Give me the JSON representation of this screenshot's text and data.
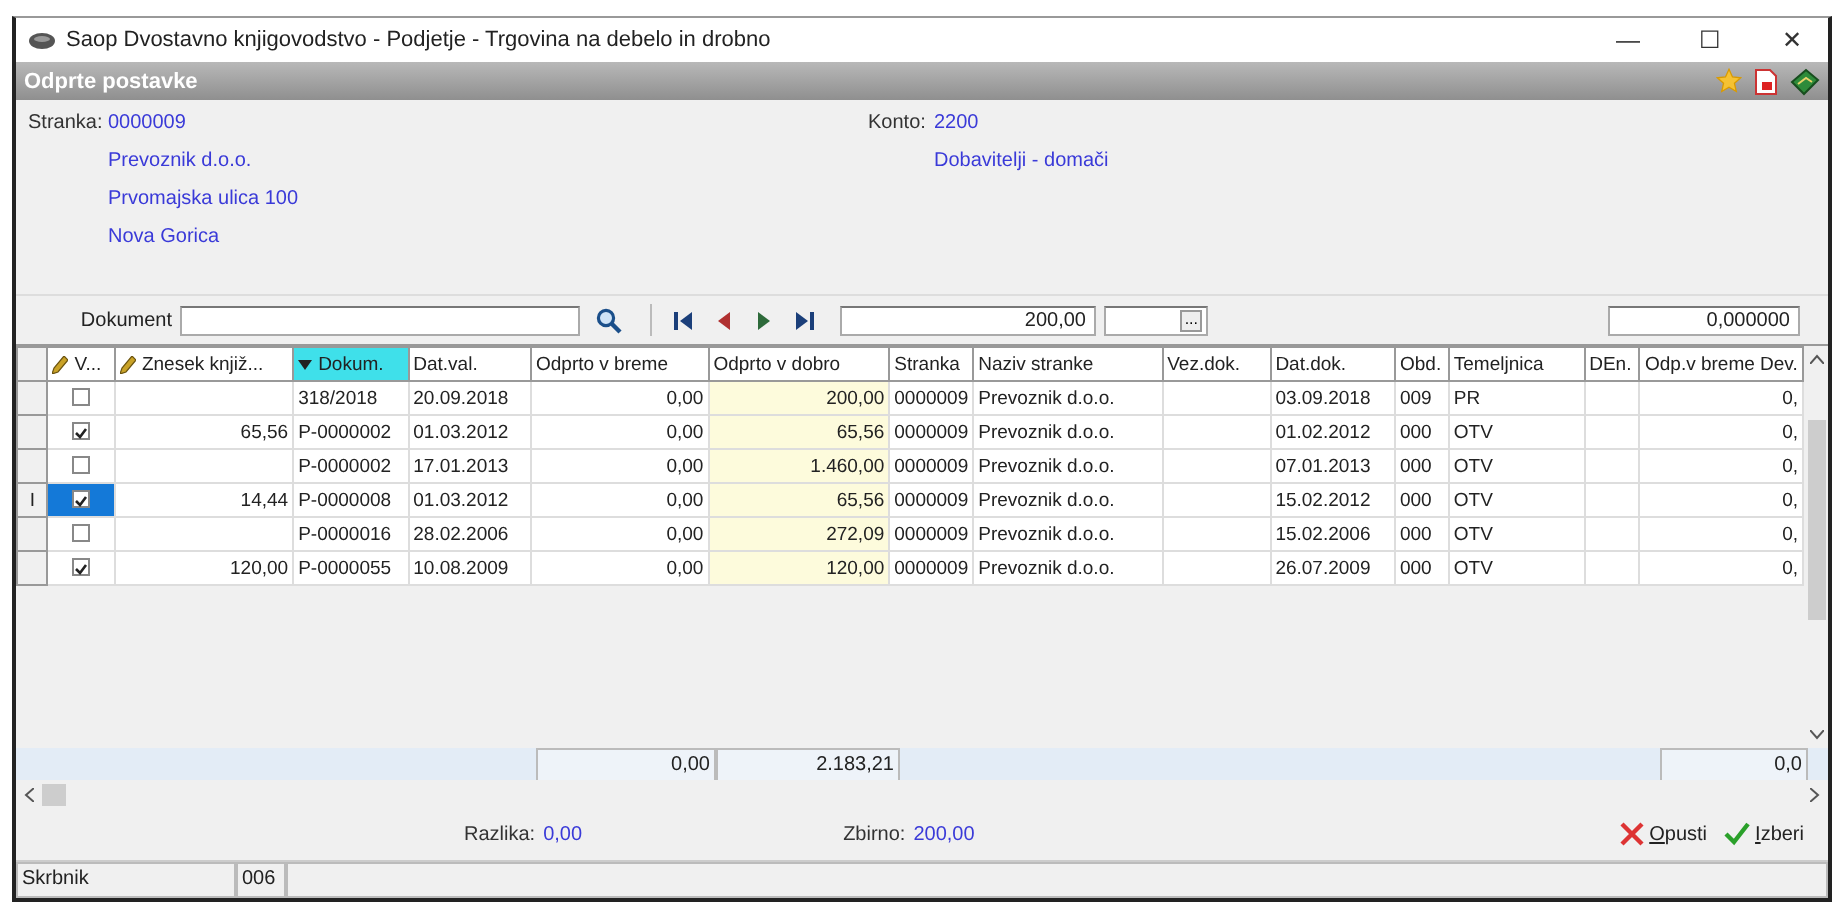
{
  "window": {
    "title": "Saop Dvostavno knjigovodstvo - Podjetje - Trgovina na debelo in drobno",
    "controls": [
      "—",
      "☐",
      "✕"
    ]
  },
  "header": {
    "title": "Odprte postavke"
  },
  "info": {
    "stranka_label": "Stranka:",
    "stranka_lines": [
      "0000009",
      "Prevoznik d.o.o.",
      "Prvomajska ulica 100",
      "Nova Gorica"
    ],
    "konto_label": "Konto:",
    "konto_lines": [
      "2200",
      "Dobavitelji - domači"
    ]
  },
  "toolbar": {
    "dokument_label": "Dokument",
    "amount": "200,00",
    "ellipsis": "...",
    "rate": "0,000000"
  },
  "columns": [
    {
      "label": "V...",
      "kind": "check",
      "editable": true,
      "sorted": false
    },
    {
      "label": "Znesek knjiž...",
      "kind": "amount",
      "editable": true,
      "sorted": false
    },
    {
      "label": "Dokum.",
      "kind": "text",
      "editable": false,
      "sorted": true
    },
    {
      "label": "Dat.val.",
      "kind": "text",
      "editable": false,
      "sorted": false
    },
    {
      "label": "Odprto v breme",
      "kind": "amount",
      "editable": false,
      "sorted": false,
      "total": "0,00"
    },
    {
      "label": "Odprto v dobro",
      "kind": "open",
      "editable": false,
      "sorted": false,
      "total": "2.183,21"
    },
    {
      "label": "Stranka",
      "kind": "text",
      "editable": false,
      "sorted": false
    },
    {
      "label": "Naziv stranke",
      "kind": "text",
      "editable": false,
      "sorted": false
    },
    {
      "label": "Vez.dok.",
      "kind": "text",
      "editable": false,
      "sorted": false
    },
    {
      "label": "Dat.dok.",
      "kind": "text",
      "editable": false,
      "sorted": false
    },
    {
      "label": "Obd.",
      "kind": "text",
      "editable": false,
      "sorted": false
    },
    {
      "label": "Temeljnica",
      "kind": "text",
      "editable": false,
      "sorted": false
    },
    {
      "label": "DEn.",
      "kind": "text",
      "editable": false,
      "sorted": false
    },
    {
      "label": "Odp.v breme Dev.",
      "kind": "amount",
      "editable": false,
      "sorted": false,
      "total": "0,0"
    }
  ],
  "rows": [
    {
      "checked": false,
      "selected": false,
      "cells": [
        null,
        null,
        "318/2018",
        "20.09.2018",
        "0,00",
        "200,00",
        "0000009",
        "Prevoznik d.o.o.",
        null,
        "03.09.2018",
        "009",
        "PR",
        null,
        "0,"
      ]
    },
    {
      "checked": true,
      "selected": false,
      "cells": [
        null,
        "65,56",
        "P-0000002",
        "01.03.2012",
        "0,00",
        "65,56",
        "0000009",
        "Prevoznik d.o.o.",
        null,
        "01.02.2012",
        "000",
        "OTV",
        null,
        "0,"
      ]
    },
    {
      "checked": false,
      "selected": false,
      "cells": [
        null,
        null,
        "P-0000002",
        "17.01.2013",
        "0,00",
        "1.460,00",
        "0000009",
        "Prevoznik d.o.o.",
        null,
        "07.01.2013",
        "000",
        "OTV",
        null,
        "0,"
      ]
    },
    {
      "checked": true,
      "selected": true,
      "row_marker": "I",
      "cells": [
        null,
        "14,44",
        "P-0000008",
        "01.03.2012",
        "0,00",
        "65,56",
        "0000009",
        "Prevoznik d.o.o.",
        null,
        "15.02.2012",
        "000",
        "OTV",
        null,
        "0,"
      ]
    },
    {
      "checked": false,
      "selected": false,
      "cells": [
        null,
        null,
        "P-0000016",
        "28.02.2006",
        "0,00",
        "272,09",
        "0000009",
        "Prevoznik d.o.o.",
        null,
        "15.02.2006",
        "000",
        "OTV",
        null,
        "0,"
      ]
    },
    {
      "checked": true,
      "selected": false,
      "cells": [
        null,
        "120,00",
        "P-0000055",
        "10.08.2009",
        "0,00",
        "120,00",
        "0000009",
        "Prevoznik d.o.o.",
        null,
        "26.07.2009",
        "000",
        "OTV",
        null,
        "0,"
      ]
    }
  ],
  "footer": {
    "razlika_label": "Razlika:",
    "razlika_value": "0,00",
    "zbirno_label": "Zbirno:",
    "zbirno_value": "200,00",
    "buttons": [
      {
        "kind": "cancel",
        "label": "Opusti"
      },
      {
        "kind": "ok",
        "label": "Izberi"
      }
    ]
  },
  "status_bar": [
    "Skrbnik",
    "006"
  ]
}
